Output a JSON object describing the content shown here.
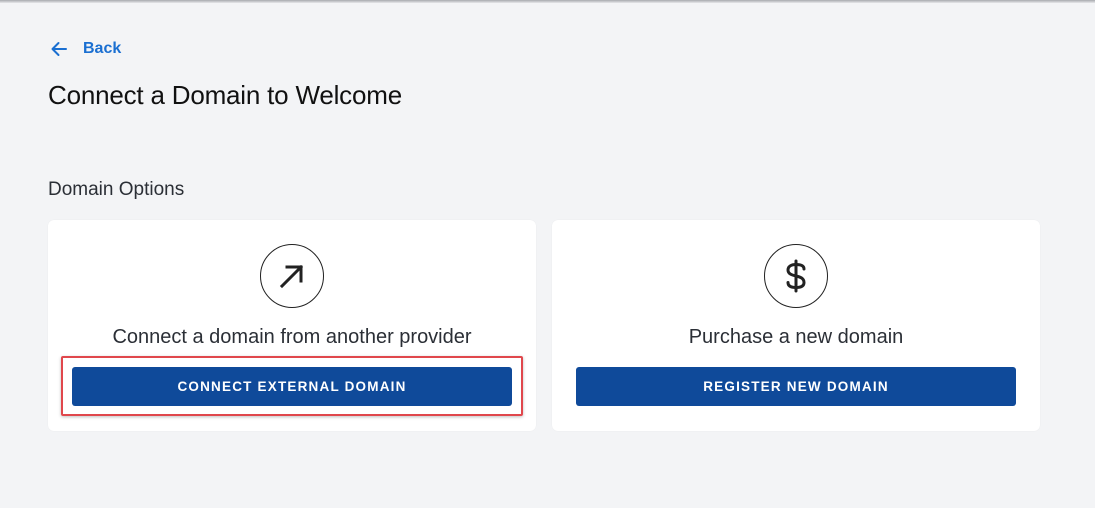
{
  "nav": {
    "back_label": "Back"
  },
  "page": {
    "title": "Connect a Domain to Welcome"
  },
  "section": {
    "title": "Domain Options"
  },
  "options": [
    {
      "icon": "arrow-up-right-icon",
      "label": "Connect a domain from another provider",
      "button_label": "CONNECT EXTERNAL DOMAIN",
      "highlighted": true
    },
    {
      "icon": "dollar-sign-icon",
      "label": "Purchase a new domain",
      "button_label": "REGISTER NEW DOMAIN",
      "highlighted": false
    }
  ],
  "colors": {
    "background": "#f3f4f6",
    "link": "#1a6fd1",
    "button": "#0f4a9a",
    "highlight": "#e0474c"
  }
}
